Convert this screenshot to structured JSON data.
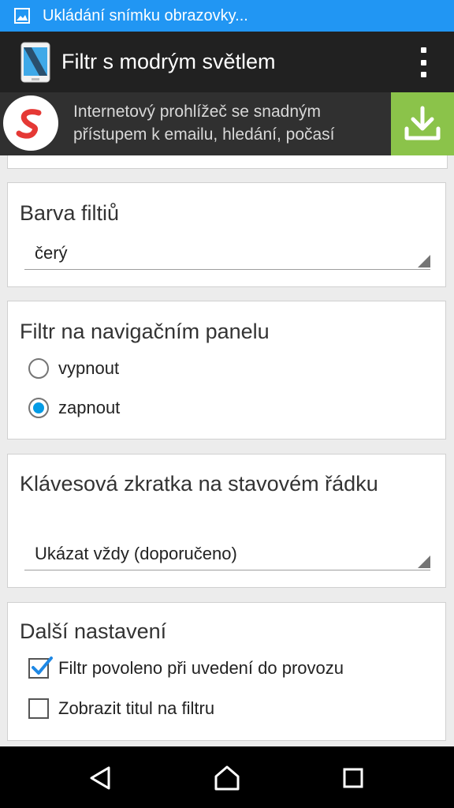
{
  "status_bar": {
    "notification_icon": "image-icon",
    "text": "Ukládání snímku obrazovky..."
  },
  "app_bar": {
    "icon": "phone-app-icon",
    "title": "Filtr s modrým světlem",
    "overflow_icon": "more-vert-icon"
  },
  "ad_banner": {
    "logo_icon": "s-logo-icon",
    "text": "Internetový prohlížeč se snadným přístupem k emailu, hledání, počasí",
    "download_icon": "download-icon"
  },
  "filter_color": {
    "title": "Barva filtiů",
    "selected": "čerý"
  },
  "nav_filter": {
    "title": "Filtr na navigačním panelu",
    "options": [
      {
        "label": "vypnout",
        "checked": false
      },
      {
        "label": "zapnout",
        "checked": true
      }
    ]
  },
  "shortcut": {
    "title": "Klávesová zkratka na stavovém řádku",
    "selected": "Ukázat vždy (doporučeno)"
  },
  "more_settings": {
    "title": "Další nastavení",
    "options": [
      {
        "label": "Filtr povoleno při uvedení do provozu",
        "checked": true
      },
      {
        "label": "Zobrazit titul na filtru",
        "checked": false
      }
    ]
  },
  "nav_bar": {
    "back_icon": "back-icon",
    "home_icon": "home-icon",
    "recents_icon": "recents-icon"
  },
  "colors": {
    "status_bar": "#2196f3",
    "app_bar": "#212121",
    "radio_accent": "#039be5",
    "check_accent": "#1e88e5",
    "download_bg": "#8bc34a"
  }
}
